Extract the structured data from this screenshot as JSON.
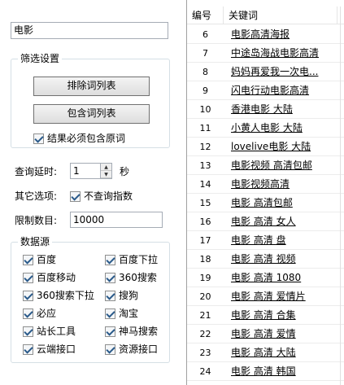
{
  "search": {
    "keyword": "电影"
  },
  "filter": {
    "title": "筛选设置",
    "exclude_label": "排除词列表",
    "include_label": "包含词列表",
    "must_contain_label": "结果必须包含原词",
    "must_contain_checked": true
  },
  "options": {
    "delay_label": "查询延时:",
    "delay_value": "1",
    "delay_unit": "秒",
    "other_label": "其它选项:",
    "no_index_label": "不查询指数",
    "no_index_checked": true,
    "limit_label": "限制数目:",
    "limit_value": "10000"
  },
  "sources": {
    "title": "数据源",
    "left": [
      {
        "label": "百度",
        "checked": true
      },
      {
        "label": "百度移动",
        "checked": true
      },
      {
        "label": "360搜索下拉",
        "checked": true
      },
      {
        "label": "必应",
        "checked": true
      },
      {
        "label": "站长工具",
        "checked": true
      },
      {
        "label": "云端接口",
        "checked": true
      }
    ],
    "right": [
      {
        "label": "百度下拉",
        "checked": true
      },
      {
        "label": "360搜索",
        "checked": true
      },
      {
        "label": "搜狗",
        "checked": true
      },
      {
        "label": "淘宝",
        "checked": true
      },
      {
        "label": "神马搜索",
        "checked": true
      },
      {
        "label": "资源接口",
        "checked": true
      }
    ]
  },
  "table": {
    "col_num": "编号",
    "col_keyword": "关键词",
    "rows": [
      {
        "num": "6",
        "kw": "电影高清海报"
      },
      {
        "num": "7",
        "kw": "中途岛海战电影高清"
      },
      {
        "num": "8",
        "kw": "妈妈再爱我一次电..."
      },
      {
        "num": "9",
        "kw": "闪电行动电影高清"
      },
      {
        "num": "10",
        "kw": "香港电影 大陆"
      },
      {
        "num": "11",
        "kw": "小黄人电影 大陆"
      },
      {
        "num": "12",
        "kw": "lovelive电影 大陆"
      },
      {
        "num": "13",
        "kw": "电影视频 高清包邮"
      },
      {
        "num": "14",
        "kw": "电影视频高清"
      },
      {
        "num": "15",
        "kw": "电影 高清包邮"
      },
      {
        "num": "16",
        "kw": "电影 高清 女人"
      },
      {
        "num": "17",
        "kw": "电影 高清 盘"
      },
      {
        "num": "18",
        "kw": "电影 高清 视频"
      },
      {
        "num": "19",
        "kw": "电影 高清 1080"
      },
      {
        "num": "20",
        "kw": "电影 高清 爱情片"
      },
      {
        "num": "21",
        "kw": "电影 高清 合集"
      },
      {
        "num": "22",
        "kw": "电影 高清 爱情"
      },
      {
        "num": "23",
        "kw": "电影 高清 大陆"
      },
      {
        "num": "24",
        "kw": "电影 高清 韩国"
      }
    ]
  }
}
